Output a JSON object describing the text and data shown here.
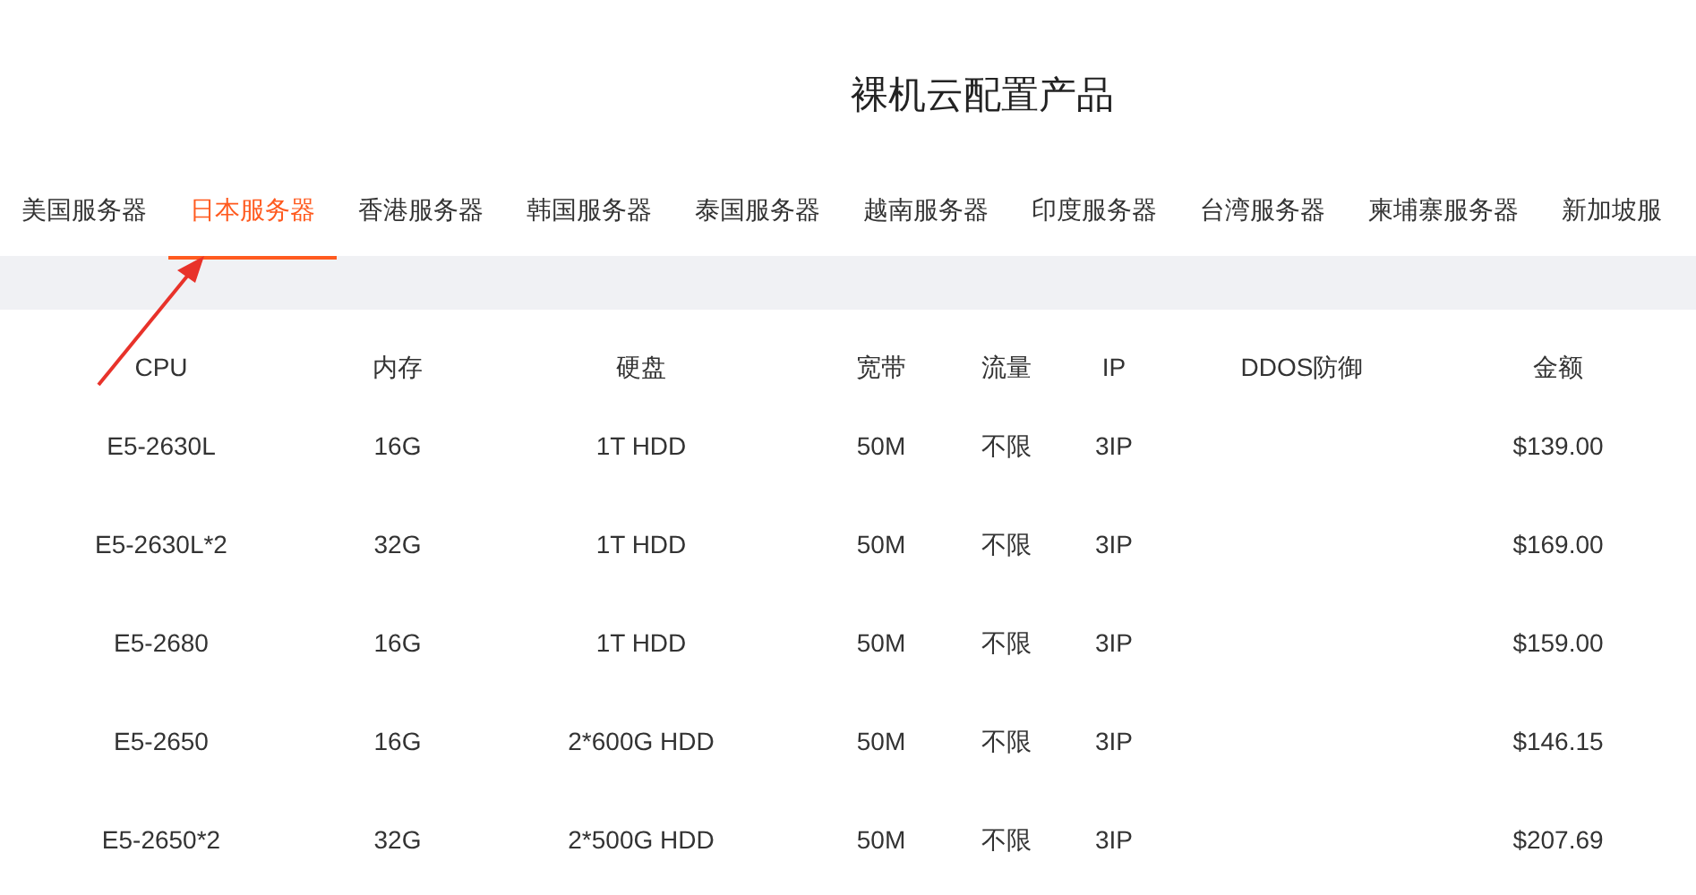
{
  "title": "裸机云配置产品",
  "tabs": [
    {
      "label": "美国服务器",
      "selected": false
    },
    {
      "label": "日本服务器",
      "selected": true
    },
    {
      "label": "香港服务器",
      "selected": false
    },
    {
      "label": "韩国服务器",
      "selected": false
    },
    {
      "label": "泰国服务器",
      "selected": false
    },
    {
      "label": "越南服务器",
      "selected": false
    },
    {
      "label": "印度服务器",
      "selected": false
    },
    {
      "label": "台湾服务器",
      "selected": false
    },
    {
      "label": "柬埔寨服务器",
      "selected": false
    },
    {
      "label": "新加坡服",
      "selected": false
    }
  ],
  "table": {
    "columns": [
      "CPU",
      "内存",
      "硬盘",
      "宽带",
      "流量",
      "IP",
      "DDOS防御",
      "金额"
    ],
    "rows": [
      [
        "E5-2630L",
        "16G",
        "1T HDD",
        "50M",
        "不限",
        "3IP",
        "",
        "$139.00"
      ],
      [
        "E5-2630L*2",
        "32G",
        "1T HDD",
        "50M",
        "不限",
        "3IP",
        "",
        "$169.00"
      ],
      [
        "E5-2680",
        "16G",
        "1T HDD",
        "50M",
        "不限",
        "3IP",
        "",
        "$159.00"
      ],
      [
        "E5-2650",
        "16G",
        "2*600G HDD",
        "50M",
        "不限",
        "3IP",
        "",
        "$146.15"
      ],
      [
        "E5-2650*2",
        "32G",
        "2*500G HDD",
        "50M",
        "不限",
        "3IP",
        "",
        "$207.69"
      ]
    ]
  }
}
